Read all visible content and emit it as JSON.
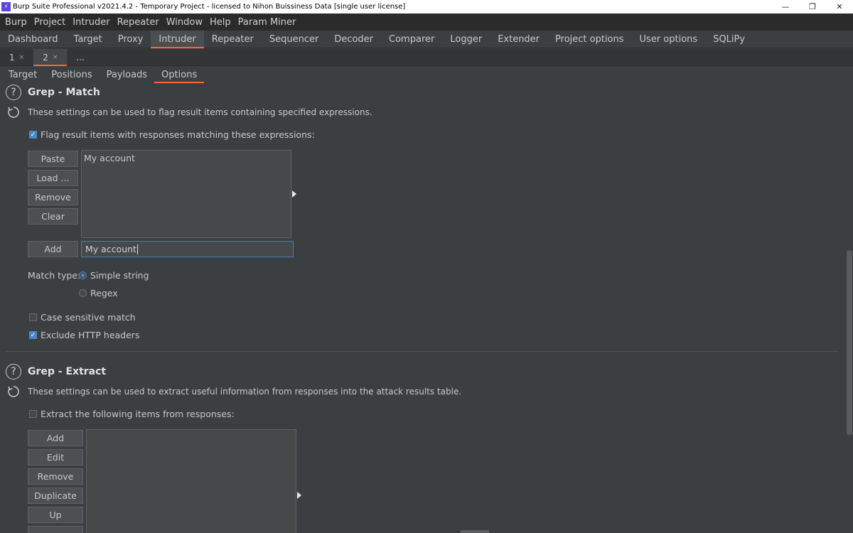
{
  "window": {
    "title": "Burp Suite Professional v2021.4.2 - Temporary Project - licensed to Nihon Buissiness Data [single user license]",
    "logo_glyph": "⚡",
    "minimize": "—",
    "restore": "❐",
    "close": "✕"
  },
  "menu": [
    "Burp",
    "Project",
    "Intruder",
    "Repeater",
    "Window",
    "Help",
    "Param Miner"
  ],
  "main_tabs": [
    "Dashboard",
    "Target",
    "Proxy",
    "Intruder",
    "Repeater",
    "Sequencer",
    "Decoder",
    "Comparer",
    "Logger",
    "Extender",
    "Project options",
    "User options",
    "SQLiPy"
  ],
  "main_tab_active": "Intruder",
  "sub_tabs": [
    {
      "label": "1",
      "close": "×"
    },
    {
      "label": "2",
      "close": "×"
    },
    {
      "label": "...",
      "close": ""
    }
  ],
  "sub_tab_active": "2",
  "section_tabs": [
    "Target",
    "Positions",
    "Payloads",
    "Options"
  ],
  "section_tab_active": "Options",
  "grep_match": {
    "title": "Grep - Match",
    "description": "These settings can be used to flag result items containing specified expressions.",
    "flag_label": "Flag result items with responses matching these expressions:",
    "flag_checked": true,
    "buttons": {
      "paste": "Paste",
      "load": "Load ...",
      "remove": "Remove",
      "clear": "Clear",
      "add": "Add"
    },
    "list_items": [
      "My account"
    ],
    "input_value": "My account",
    "match_type_label": "Match type:",
    "match_simple": "Simple string",
    "match_regex": "Regex",
    "match_selected": "Simple string",
    "case_sensitive_label": "Case sensitive match",
    "case_sensitive_checked": false,
    "exclude_headers_label": "Exclude HTTP headers",
    "exclude_headers_checked": true
  },
  "grep_extract": {
    "title": "Grep - Extract",
    "description": "These settings can be used to extract useful information from responses into the attack results table.",
    "extract_label": "Extract the following items from responses:",
    "extract_checked": false,
    "buttons": {
      "add": "Add",
      "edit": "Edit",
      "remove": "Remove",
      "duplicate": "Duplicate",
      "up": "Up"
    }
  },
  "icons": {
    "help": "?",
    "check": "✓"
  },
  "colors": {
    "accent": "#ff6633",
    "checkbox": "#4a88c7",
    "background": "#3c3f41"
  }
}
